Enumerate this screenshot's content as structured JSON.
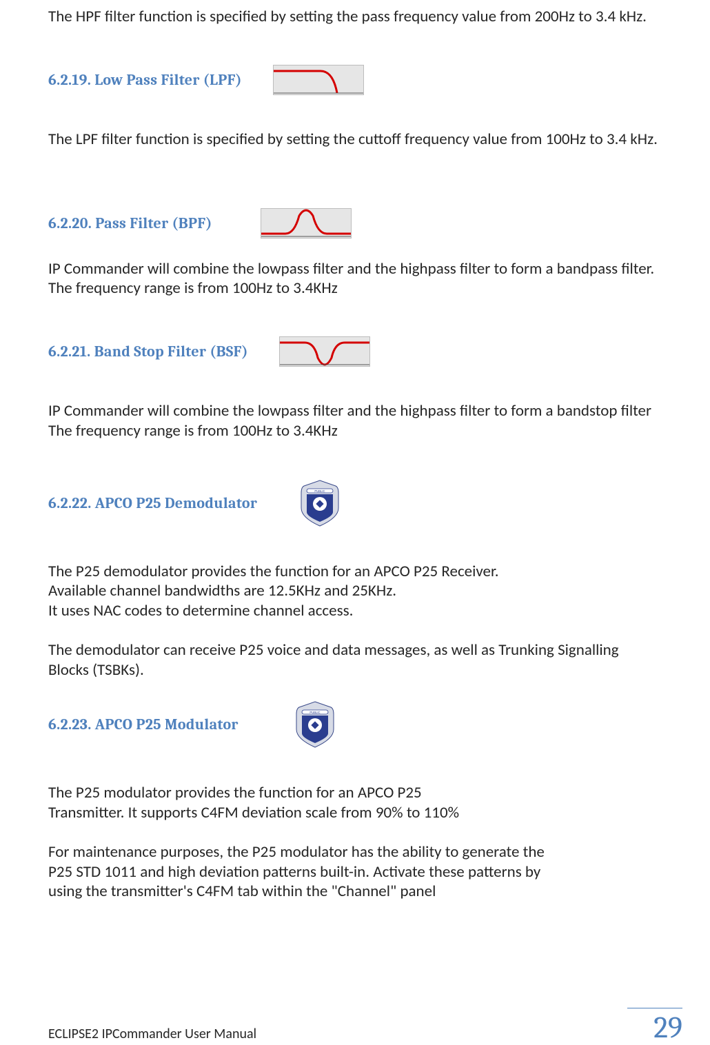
{
  "intro_text": "The HPF filter function is specified by setting the pass frequency value from 200Hz to 3.4 kHz.",
  "sections": {
    "lpf": {
      "heading": "6.2.19. Low Pass Filter (LPF)",
      "body": "The LPF filter function is specified by setting the cuttoff frequency value from 100Hz to 3.4 kHz."
    },
    "bpf": {
      "heading": "6.2.20. Pass Filter (BPF)",
      "body": "IP Commander will combine the lowpass filter and the highpass filter to form a bandpass filter. The frequency range is from 100Hz to 3.4KHz"
    },
    "bsf": {
      "heading": "6.2.21. Band Stop Filter (BSF)",
      "body": "IP Commander will combine the lowpass filter and the highpass filter to form a bandstop filter The frequency range is from 100Hz to 3.4KHz"
    },
    "demod": {
      "heading": "6.2.22. APCO P25 Demodulator",
      "body1": "The P25 demodulator provides the function for an APCO P25 Receiver.",
      "body2": "Available channel bandwidths are 12.5KHz and 25KHz.",
      "body3": "It uses NAC codes to determine channel access.",
      "body4": "The demodulator can receive P25 voice and data messages, as well as Trunking Signalling Blocks (TSBKs)."
    },
    "mod": {
      "heading": "6.2.23. APCO P25 Modulator",
      "body1": "The P25 modulator provides the function for an APCO P25",
      "body2": "Transmitter. It supports C4FM deviation scale from 90% to 110%",
      "body3": "For maintenance purposes, the P25 modulator has the ability to generate the P25 STD 1011 and high deviation patterns built-in.  Activate these patterns by using the transmitter's C4FM tab within the \"Channel\" panel"
    }
  },
  "footer": {
    "title": "ECLIPSE2 IPCommander User Manual",
    "page": "29"
  },
  "icons": {
    "lpf": "low-pass-filter-icon",
    "bpf": "band-pass-filter-icon",
    "bsf": "band-stop-filter-icon",
    "apco": "apco-p25-badge-icon"
  }
}
